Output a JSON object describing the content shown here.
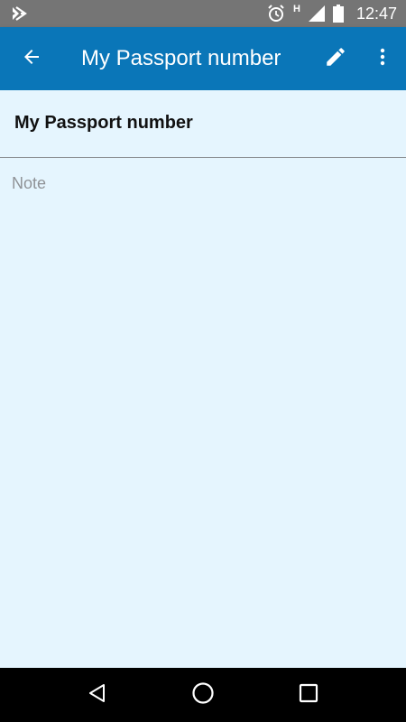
{
  "status_bar": {
    "time": "12:47",
    "network_label": "H",
    "icons": [
      "app-notification-icon",
      "alarm-icon",
      "signal-icon",
      "battery-icon"
    ]
  },
  "app_bar": {
    "title": "My Passport number",
    "icons": [
      "back-arrow-icon",
      "pencil-icon",
      "more-vert-icon"
    ],
    "color": "#0a76b8"
  },
  "entry": {
    "title": "My Passport number",
    "note_placeholder": "Note",
    "background": "#e5f5fe"
  },
  "nav_bar": {
    "icons": [
      "back-triangle-icon",
      "home-circle-icon",
      "recents-square-icon"
    ]
  }
}
